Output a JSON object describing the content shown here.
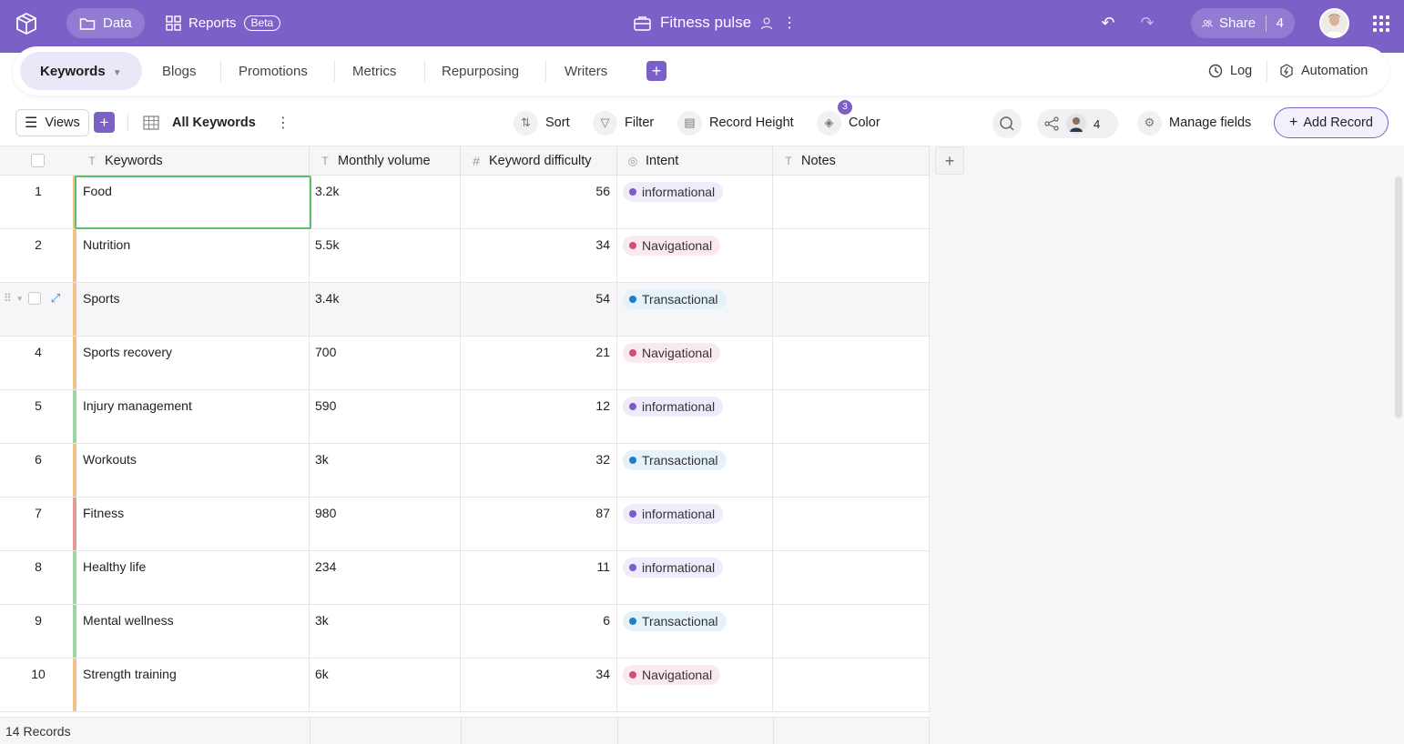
{
  "topbar": {
    "nav": [
      {
        "label": "Data",
        "icon": "folder-icon",
        "active": true
      },
      {
        "label": "Reports",
        "icon": "grid-icon",
        "badge": "Beta",
        "active": false
      }
    ],
    "app_title": "Fitness pulse",
    "share_label": "Share",
    "share_count": "4"
  },
  "tabs": {
    "active": "Keywords",
    "items": [
      "Blogs",
      "Promotions",
      "Metrics",
      "Repurposing",
      "Writers"
    ],
    "log_label": "Log",
    "automation_label": "Automation"
  },
  "toolbar": {
    "views_label": "Views",
    "view_name": "All Keywords",
    "sort_label": "Sort",
    "filter_label": "Filter",
    "record_height_label": "Record Height",
    "color_label": "Color",
    "color_badge": "3",
    "collab_count": "4",
    "manage_fields_label": "Manage fields",
    "add_record_label": "Add Record"
  },
  "columns": [
    {
      "name": "Keywords",
      "icon": "text-field-icon"
    },
    {
      "name": "Monthly volume",
      "icon": "text-field-icon"
    },
    {
      "name": "Keyword difficulty",
      "icon": "number-field-icon"
    },
    {
      "name": "Intent",
      "icon": "single-select-icon"
    },
    {
      "name": "Notes",
      "icon": "text-field-icon"
    }
  ],
  "intent_colors": {
    "informational": {
      "dot": "#7b5cc8",
      "bg": "#efebfb"
    },
    "Navigational": {
      "dot": "#d44c7e",
      "bg": "#fbe9f0"
    },
    "Transactional": {
      "dot": "#1f7fc4",
      "bg": "#e6f2fa"
    }
  },
  "rows": [
    {
      "num": "1",
      "keyword": "Food",
      "volume": "3.2k",
      "difficulty": "56",
      "intent": "informational",
      "color": "#f1c38b"
    },
    {
      "num": "2",
      "keyword": "Nutrition",
      "volume": "5.5k",
      "difficulty": "34",
      "intent": "Navigational",
      "color": "#f1c38b"
    },
    {
      "num": "",
      "keyword": "Sports",
      "volume": "3.4k",
      "difficulty": "54",
      "intent": "Transactional",
      "color": "#f1c38b"
    },
    {
      "num": "4",
      "keyword": "Sports recovery",
      "volume": "700",
      "difficulty": "21",
      "intent": "Navigational",
      "color": "#f1c38b"
    },
    {
      "num": "5",
      "keyword": "Injury management",
      "volume": "590",
      "difficulty": "12",
      "intent": "informational",
      "color": "#9fd6a6"
    },
    {
      "num": "6",
      "keyword": "Workouts",
      "volume": "3k",
      "difficulty": "32",
      "intent": "Transactional",
      "color": "#f1c38b"
    },
    {
      "num": "7",
      "keyword": "Fitness",
      "volume": "980",
      "difficulty": "87",
      "intent": "informational",
      "color": "#e59a9a"
    },
    {
      "num": "8",
      "keyword": "Healthy life",
      "volume": "234",
      "difficulty": "11",
      "intent": "informational",
      "color": "#9fd6a6"
    },
    {
      "num": "9",
      "keyword": "Mental wellness",
      "volume": "3k",
      "difficulty": "6",
      "intent": "Transactional",
      "color": "#9fd6a6"
    },
    {
      "num": "10",
      "keyword": "Strength training",
      "volume": "6k",
      "difficulty": "34",
      "intent": "Navigational",
      "color": "#f1c38b"
    }
  ],
  "footer": {
    "records_label": "14 Records"
  },
  "colors": {
    "brand": "#7b60c8",
    "selected_cell": "#5cbf6d"
  }
}
